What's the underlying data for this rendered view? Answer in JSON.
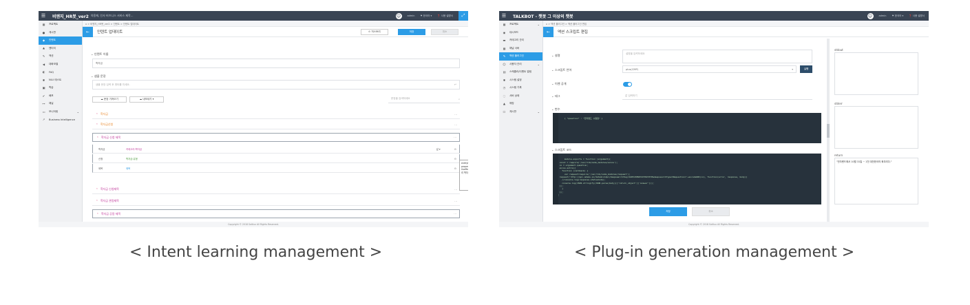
{
  "captions": {
    "left": "< Intent learning management >",
    "right": "< Plug-in generation management >"
  },
  "left": {
    "app_title": "비엔지_HR봇_ver2",
    "app_subtitle": "의용제, 인사 비즈니스 서비스 제작...",
    "user": "admin",
    "lang": "한국어",
    "help": "사용 설명서",
    "sidebar": [
      {
        "icon": "grid-icon",
        "glyph": "▦",
        "label": "프로젝트"
      },
      {
        "icon": "chat-icon",
        "glyph": "●",
        "label": "게시판"
      },
      {
        "icon": "intent-icon",
        "glyph": "◆",
        "label": "인텐트",
        "active": true
      },
      {
        "icon": "entity-icon",
        "glyph": "♣",
        "label": "엔티티"
      },
      {
        "icon": "action-icon",
        "glyph": "✎",
        "label": "액션"
      },
      {
        "icon": "response-icon",
        "glyph": "◀",
        "label": "대화모델"
      },
      {
        "icon": "qa-icon",
        "glyph": "◐",
        "label": "FAQ"
      },
      {
        "icon": "nlu-icon",
        "glyph": "✱",
        "label": "NLU 테스트"
      },
      {
        "icon": "learn-icon",
        "glyph": "▣",
        "label": "학습"
      },
      {
        "icon": "deploy-icon",
        "glyph": "✔",
        "label": "배포"
      },
      {
        "icon": "channel-icon",
        "glyph": "⊶",
        "label": "채널"
      },
      {
        "icon": "monitor-icon",
        "glyph": "▭",
        "label": "모니터링",
        "caret": true
      },
      {
        "icon": "bi-icon",
        "glyph": "↗",
        "label": "Business Intelligence"
      }
    ],
    "breadcrumb": "⌂ > 비엔지_HR봇_ver2 > 인텐트 > 인텐트 업데이트",
    "page_title": "인텐트 업데이트",
    "btn_history": "⊙ 히스토리",
    "btn_save": "저장",
    "btn_cancel": "취소",
    "intent_name_label": "인텐트 이름",
    "intent_name_value": "학자금",
    "examples_label": "샘플 문장",
    "examples_placeholder": "샘플 문장 입력 후 엔터를 치세요.",
    "btn_import": "☁ 문장 가져오기",
    "btn_export": "☁ 내보내기 ▾",
    "search_placeholder": "문장을 검색하세요",
    "rows": [
      {
        "text": "학자금",
        "color": "orange"
      },
      {
        "text": "학자금신청",
        "color": "orange"
      },
      {
        "text": "학자금 신청 제목",
        "color": "magenta",
        "boxed": true
      }
    ],
    "slots": [
      {
        "name": "학자금",
        "value": "카테고리:학자금",
        "color": "magenta"
      },
      {
        "name": "신청",
        "value": "학자금:유형",
        "color": "green"
      },
      {
        "name": "제목",
        "value": "제목",
        "color": "blue"
      }
    ],
    "slot_dropdown": "값 ▾",
    "popup_items": [
      "entityName 카테고리",
      "propertyName 학자금",
      "UseResourceType 카테고리 학자금"
    ],
    "rows2": [
      {
        "text": "학자금 신청제목",
        "color": "magenta"
      },
      {
        "text": "학자금 관람제목",
        "color": "magenta"
      },
      {
        "text": "학자금 공람 제목",
        "color": "magenta",
        "boxed": true
      }
    ],
    "footer": "Copyright © 2018 Saltlux All Rights Reserved."
  },
  "right": {
    "app_title": "TALKBOT - 챗봇 그 이상의 챗봇",
    "user": "admin",
    "lang": "한국어",
    "help": "사용 설명서",
    "sidebar": [
      {
        "icon": "grid-icon",
        "glyph": "▦",
        "label": "프로젝트",
        "caret": true
      },
      {
        "icon": "dashboard-icon",
        "glyph": "◉",
        "label": "대시보드"
      },
      {
        "icon": "category-icon",
        "glyph": "▬",
        "label": "카테고리 관리"
      },
      {
        "icon": "grid-icon",
        "glyph": "▦",
        "label": "채널 서버"
      },
      {
        "icon": "script-icon",
        "glyph": "✎",
        "label": "액션 플러그인",
        "active": true
      },
      {
        "icon": "user-icon",
        "glyph": "☺",
        "label": "사용자 관리",
        "caret": true
      },
      {
        "icon": "calendar-icon",
        "glyph": "▤",
        "label": "스케줄러/이벤트 알림"
      },
      {
        "icon": "gear-icon",
        "glyph": "✱",
        "label": "시스템 설정"
      },
      {
        "icon": "log-icon",
        "glyph": "◷",
        "label": "시스템 기록"
      },
      {
        "icon": "server-icon",
        "glyph": "◌",
        "label": "서버 상태"
      },
      {
        "icon": "warn-icon",
        "glyph": "▲",
        "label": "매칭"
      },
      {
        "icon": "board-icon",
        "glyph": "☐",
        "label": "게시판",
        "caret": true
      }
    ],
    "breadcrumb": "⌂ > 액션 플러그인 > 액션 플러그인 편집",
    "page_title": "액션 스크립트 편집",
    "desc_label": "설명",
    "desc_placeholder": "설명을 입력하세요",
    "lang_label": "스크립트 언어",
    "lang_value": "plus(CMP)",
    "run_button": "실행",
    "public_label": "이벤 공개",
    "tag_label": "태그",
    "tag_placeholder": "값 입력하기",
    "vars_label": "변수",
    "vars_code": "{ \"question\" : \"전자랜드 수원점\" }",
    "script_label": "스크립트 코드",
    "script_code": "module.exports = function (argument){\n  const = require('/usr/lib/node_modules/axios');\n  co = argument.question;\n  axios.extra({\n    function (callback) {\n      var request=require('/usr/lib/node_modules/request');\n  request('http://api.adams.ai/datamixiApi/deepsearch?key=4265438983473823370&deepsearchType=0&question='+encodeURI(co), function(error, response, body){\n    //console.log(response.statusCode);\n    console.log(JSON.stringify(JSON.parse(body))['return_object']['answer']));\n  });\n    }\n  });\n};",
    "save_button": "저장",
    "cancel_button": "취소",
    "stdout_label": "stdout",
    "stderr_label": "stderr",
    "return_label": "return",
    "return_value": "\"전자랜드에서 10월 31일 ~ 1천 대전한국의 화무리다.\"",
    "footer": "Copyright © 2018 Saltlux All Rights Reserved."
  }
}
